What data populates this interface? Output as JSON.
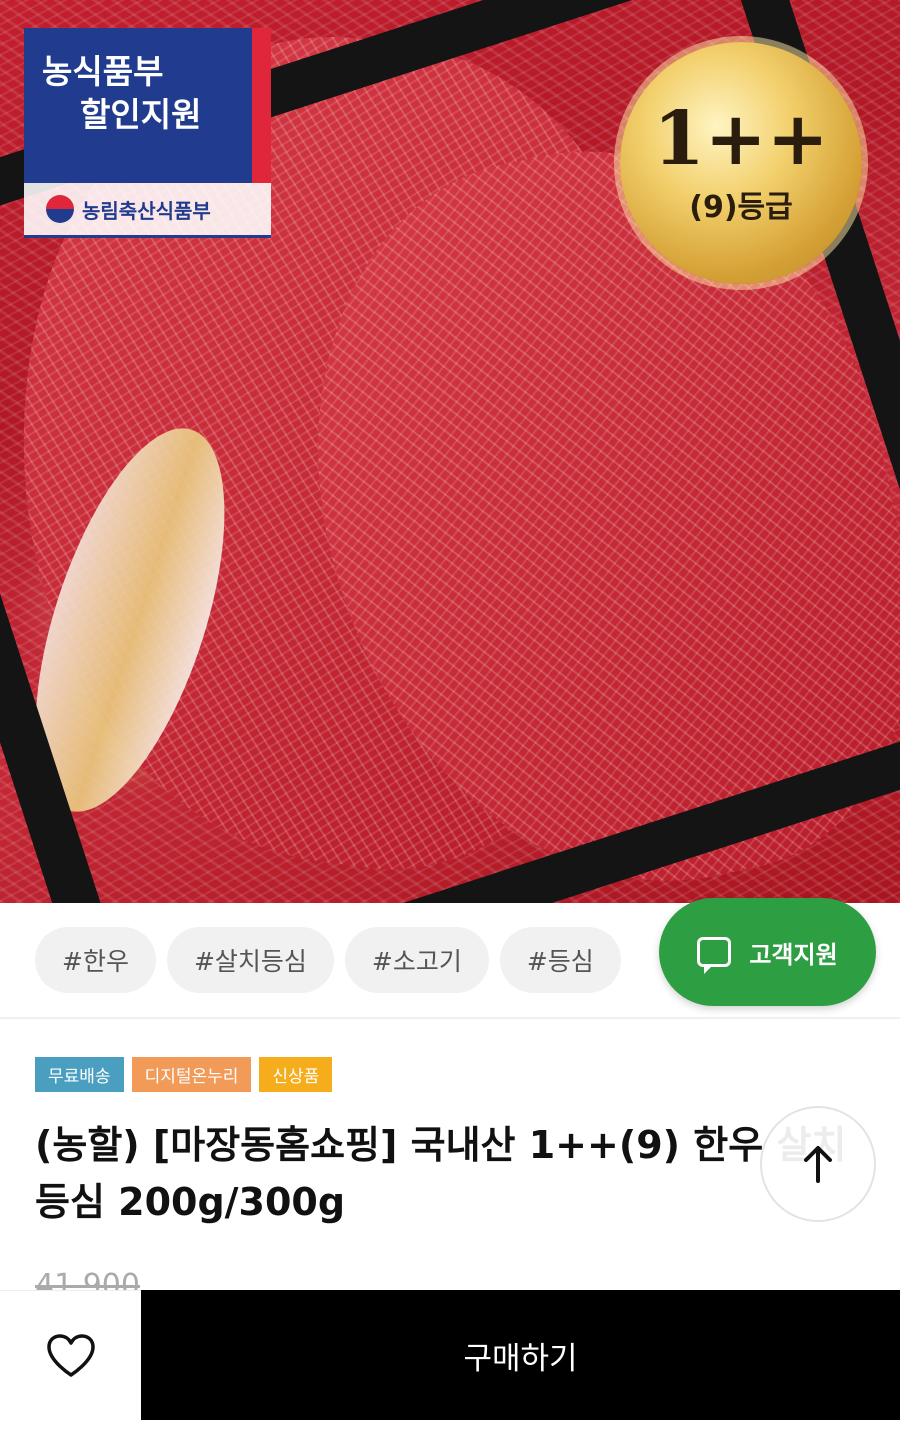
{
  "hero": {
    "promo_badge": {
      "line1": "농식품부",
      "line2": "할인지원",
      "ministry": "농림축산식품부"
    },
    "grade_medal": {
      "grade": "1++",
      "sub": "(9)등급"
    }
  },
  "tags": [
    "#한우",
    "#살치등심",
    "#소고기",
    "#등심"
  ],
  "support_button": {
    "label": "고객지원",
    "icon": "chat-icon",
    "color": "#2e9e43"
  },
  "badges": [
    {
      "label": "무료배송",
      "color": "#4a9fc0"
    },
    {
      "label": "디지털온누리",
      "color": "#f29a57"
    },
    {
      "label": "신상품",
      "color": "#f5ad1c"
    }
  ],
  "product": {
    "title": "(농할) [마장동홈쇼핑] 국내산 1++(9) 한우 살치등심 200g/300g",
    "original_price": "41,900"
  },
  "scroll_top": {
    "icon": "arrow-up-icon"
  },
  "bottom_bar": {
    "wishlist_icon": "heart-icon",
    "buy_label": "구매하기"
  }
}
